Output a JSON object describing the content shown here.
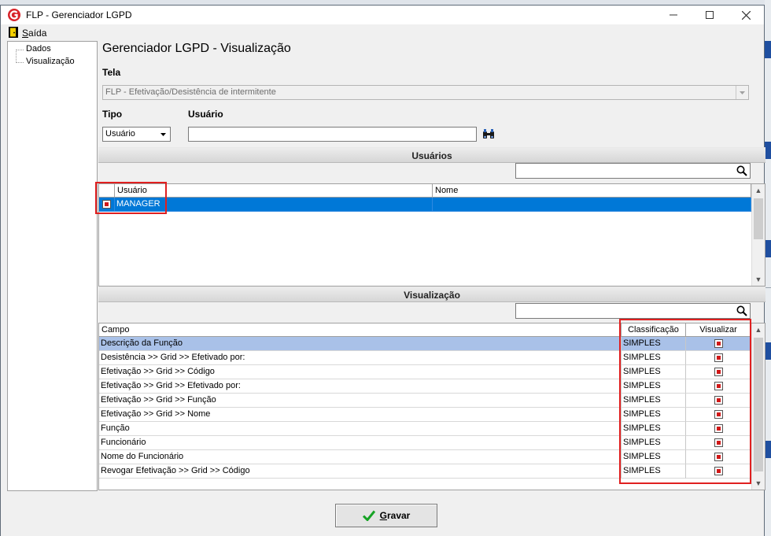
{
  "window": {
    "title": "FLP - Gerenciador LGPD"
  },
  "menu": {
    "exit_first": "S",
    "exit_rest": "aída"
  },
  "tree": {
    "items": [
      "Dados",
      "Visualização"
    ]
  },
  "page": {
    "title": "Gerenciador LGPD - Visualização"
  },
  "form": {
    "tela_label": "Tela",
    "tela_value": "FLP - Efetivação/Desistência de intermitente",
    "tipo_label": "Tipo",
    "tipo_value": "Usuário",
    "usuario_label": "Usuário",
    "usuario_value": ""
  },
  "usuarios": {
    "section_title": "Usuários",
    "search_value": "",
    "columns": [
      "Usuário",
      "Nome"
    ],
    "rows": [
      {
        "checked": true,
        "usuario": "MANAGER",
        "nome": ""
      }
    ]
  },
  "visualizacao": {
    "section_title": "Visualização",
    "search_value": "",
    "columns": [
      "Campo",
      "Classificação",
      "Visualizar"
    ],
    "rows": [
      {
        "campo": "Descrição da Função",
        "classificacao": "SIMPLES",
        "visualizar": true
      },
      {
        "campo": "Desistência >> Grid >> Efetivado por:",
        "classificacao": "SIMPLES",
        "visualizar": true
      },
      {
        "campo": "Efetivação >> Grid >> Código",
        "classificacao": "SIMPLES",
        "visualizar": true
      },
      {
        "campo": "Efetivação >> Grid >> Efetivado por:",
        "classificacao": "SIMPLES",
        "visualizar": true
      },
      {
        "campo": "Efetivação >> Grid >> Função",
        "classificacao": "SIMPLES",
        "visualizar": true
      },
      {
        "campo": "Efetivação >> Grid >> Nome",
        "classificacao": "SIMPLES",
        "visualizar": true
      },
      {
        "campo": "Função",
        "classificacao": "SIMPLES",
        "visualizar": true
      },
      {
        "campo": "Funcionário",
        "classificacao": "SIMPLES",
        "visualizar": true
      },
      {
        "campo": "Nome do Funcionário",
        "classificacao": "SIMPLES",
        "visualizar": true
      },
      {
        "campo": "Revogar Efetivação >> Grid >> Código",
        "classificacao": "SIMPLES",
        "visualizar": true
      }
    ]
  },
  "footer": {
    "save_first": "G",
    "save_rest": "ravar"
  },
  "colors": {
    "selected_row": "#0078d7",
    "first_row": "#a9c1e8",
    "highlight_box": "#e02020",
    "check_red": "#d01818",
    "background_tab": "#1f4fa0"
  },
  "icons": {
    "app": "flp-logo-icon",
    "exit": "exit-door-icon",
    "search": "magnifier-icon",
    "binoculars": "binoculars-icon",
    "save": "green-check-icon"
  }
}
